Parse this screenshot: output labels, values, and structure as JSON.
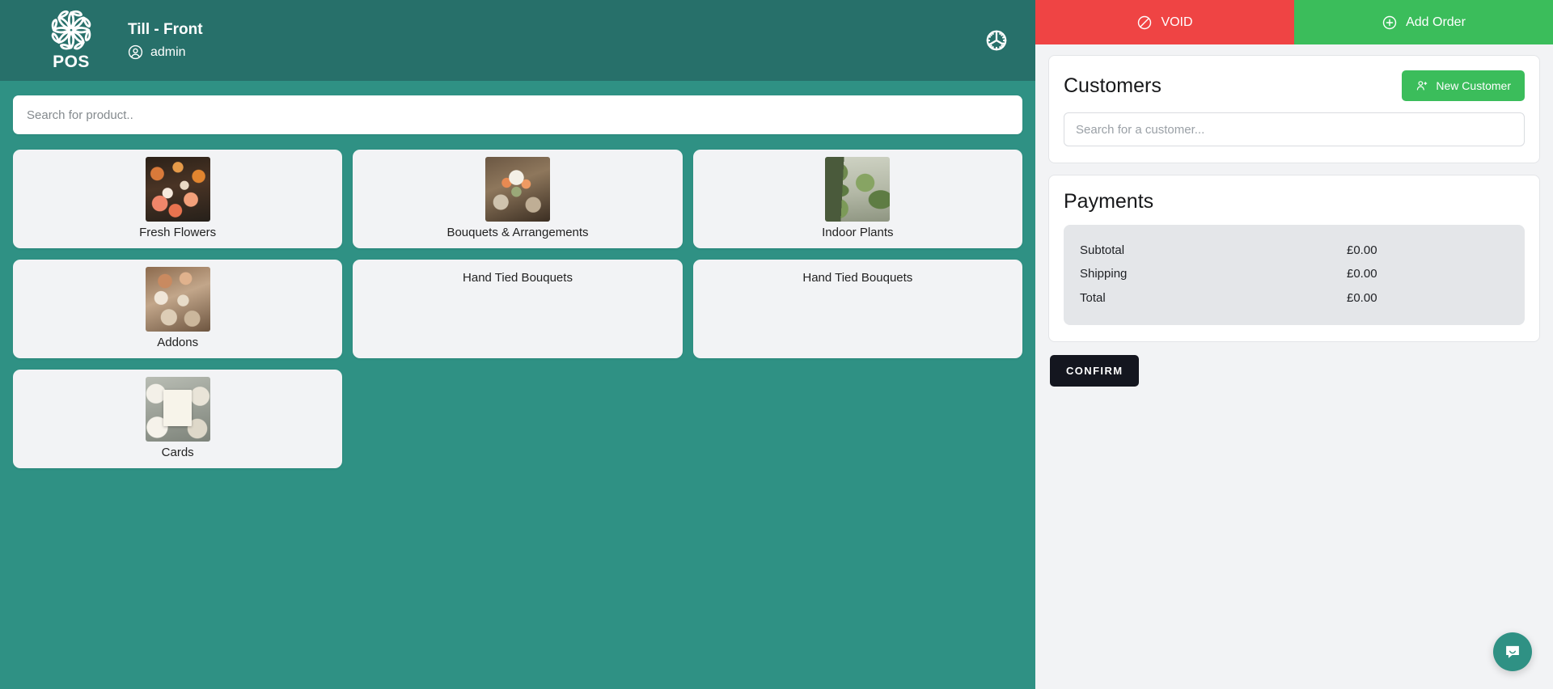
{
  "brand": {
    "word": "POS",
    "logo_icon": "floral-mandala-logo"
  },
  "header": {
    "till_name": "Till - Front",
    "user_name": "admin",
    "user_icon": "user-circle-icon",
    "settings_icon": "gear-icon"
  },
  "search": {
    "product_placeholder": "Search for product.."
  },
  "categories": [
    {
      "label": "Fresh Flowers",
      "thumb": "t-fresh",
      "has_image": true
    },
    {
      "label": "Bouquets & Arrangements",
      "thumb": "t-bouquet",
      "has_image": true
    },
    {
      "label": "Indoor Plants",
      "thumb": "t-plants",
      "has_image": true
    },
    {
      "label": "Addons",
      "thumb": "t-addons",
      "has_image": true
    },
    {
      "label": "Hand Tied Bouquets",
      "thumb": "",
      "has_image": false
    },
    {
      "label": "Hand Tied Bouquets",
      "thumb": "",
      "has_image": false
    },
    {
      "label": "Cards",
      "thumb": "t-cards",
      "has_image": true
    }
  ],
  "actions": {
    "void_label": "VOID",
    "void_icon": "no-entry-slash-icon",
    "void_color": "#ef4444",
    "add_order_label": "Add Order",
    "add_order_icon": "plus-circle-icon",
    "add_order_color": "#3bbd5b"
  },
  "customers": {
    "title": "Customers",
    "new_customer_label": "New Customer",
    "new_customer_icon": "person-add-icon",
    "search_placeholder": "Search for a customer..."
  },
  "payments": {
    "title": "Payments",
    "rows": [
      {
        "label": "Subtotal",
        "value": "£0.00"
      },
      {
        "label": "Shipping",
        "value": "£0.00"
      },
      {
        "label": "Total",
        "value": "£0.00"
      }
    ]
  },
  "confirm": {
    "label": "CONFIRM"
  },
  "chat": {
    "icon": "chat-bubble-smile-icon"
  },
  "theme": {
    "header_teal": "#27706a",
    "body_teal": "#2f9184",
    "panel_bg": "#f2f3f5",
    "confirm_dark": "#14161f"
  }
}
